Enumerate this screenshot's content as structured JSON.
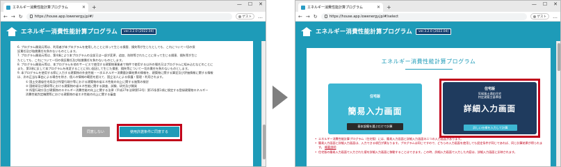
{
  "left": {
    "tab_title": "エネルギー消費性能計算プログラム",
    "url": "https://house.app.lowenergy.jp/#/",
    "guest": "ゲスト",
    "app_title": "エネルギー消費性能計算プログラム",
    "version": "ver.3.2.0 (2022.04)",
    "terms": [
      "6. プログラム開発元等は、利用者が本プログラムを使用したことに伴って生じる損害、損失等が生じたとしても、これについて一切の保",
      "   証責任及び賠償責任を負わないものとします。",
      "7. プログラム開発元等は、第4項により本プログラムの全部又は一部が変更、追加、削除等されたことに伴って生じる損害、損失等が生じ",
      "   たとしても、これについて一切の保証責任及び賠償責任を負わないものとします。",
      "8. プログラム開発元等は、本プログラムを他のサービスで使用する建築物事業者で物件で使用する以外の場合又はプログラムに組み込むなどのことに",
      "   また、第3項に反して本プログラムを改変することに伴い起因して生じた損害、損失等について一切の責任を負わないものとします。",
      "9. 本プログラムを使用する際に入力する建築物の外皮性能・一次エネルギー消費量計算結果の情報を、建築物に関する算定及び評価情報に関する情報",
      "   は、次の正当な事由による場合を除き、個人の情報の範囲を超えて、国立法人による保護・管理・利用されます。"
    ],
    "terms_list": [
      "① 国土交通省住宅局及び所管行政庁等における建築物の省エネ性能の向上に関する施策の検討",
      "② 国総研及び建研等における建築物の省エネ性能に関する調査、試験、研究及び開発",
      "③ 所管行政庁及び建築物のエネルギー消費性能の向上に関する法律（平成27年法律第53号）第15条第1項に規定する登録建築物エネルギー",
      "   消費性能判定機関等における建築物の省エネ性能の向上に関する審査"
    ],
    "deny_label": "同意しない",
    "agree_label": "使用許諾条件に同意する"
  },
  "right": {
    "tab_title": "エネルギー消費性能計算プログラム",
    "url": "https://house.app.lowenergy.jp/#/select",
    "guest": "ゲスト",
    "app_title": "エネルギー消費性能計算プログラム",
    "version": "ver.3.2.0 (2022.04)",
    "page_title": "エネルギー消費性能計算プログラム",
    "simple": {
      "eyebrow": "住宅版",
      "title": "簡易入力画面",
      "button": "基本設備を選ぶだけで計算"
    },
    "detail": {
      "eyebrow": "住宅版",
      "sub1": "気候風土適応住宅",
      "sub2": "特定建築主基準版",
      "title": "詳細入力画面",
      "button": "詳しい仕様を入力して計算"
    },
    "notes": [
      "エネルギー消費性能計算プログラム（住宅版）には、簡易入力画面と詳細入力画面の二つの入力画面があります。",
      "簡易入力画面と詳細入力画面は、入力できる項目が異なります。プログラムは同じですので、どちらの入力画面を使用しても設定条件が同じであれば、同じ計算結果が得られます。",
      "住宅版の簡易入力画面で入力された値を詳細入力画面に移動することはできます。この時、詳細入力画面で入力した内容は、詳細入力画面に反映されます。"
    ],
    "notes_link": "概要説明"
  }
}
